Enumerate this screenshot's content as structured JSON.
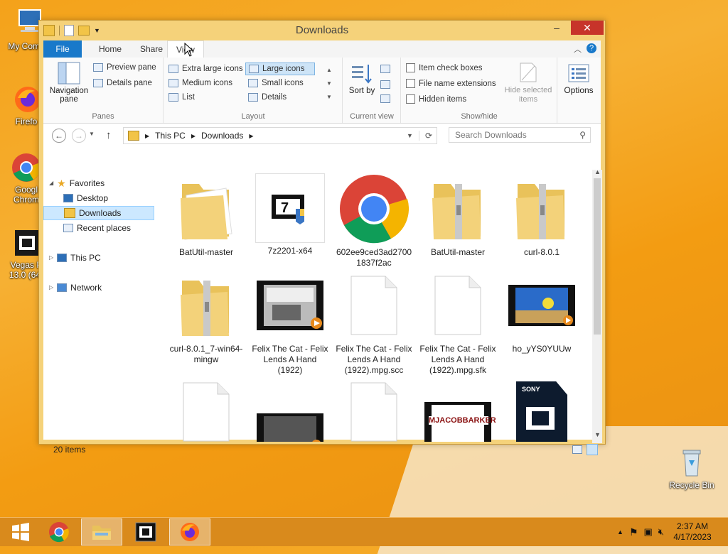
{
  "desktop": {
    "icons": [
      {
        "label": "My Comp",
        "icon": "computer-icon"
      },
      {
        "label": "Firefo",
        "icon": "firefox-icon"
      },
      {
        "label": "Googl Chrom",
        "icon": "chrome-icon"
      },
      {
        "label": "Vegas P 13.0 (64-",
        "icon": "vegas-icon"
      },
      {
        "label": "Recycle Bin",
        "icon": "recycle-bin-icon"
      }
    ]
  },
  "window": {
    "title": "Downloads",
    "controls": {
      "minimize": "–",
      "maximize": "☐",
      "close": "✕"
    }
  },
  "ribbon": {
    "tabs": [
      "File",
      "Home",
      "Share",
      "View"
    ],
    "panes": {
      "navigation_pane": "Navigation pane",
      "preview_pane": "Preview pane",
      "details_pane": "Details pane",
      "label": "Panes"
    },
    "layout": {
      "options": [
        "Extra large icons",
        "Large icons",
        "Medium icons",
        "Small icons",
        "List",
        "Details"
      ],
      "selected": "Large icons",
      "label": "Layout"
    },
    "current_view": {
      "sort_by": "Sort by",
      "label": "Current view"
    },
    "show_hide": {
      "item_check_boxes": "Item check boxes",
      "file_name_extensions": "File name extensions",
      "hidden_items": "Hidden items",
      "hide_selected": "Hide selected items",
      "label": "Show/hide"
    },
    "options": "Options"
  },
  "address": {
    "path": [
      "This PC",
      "Downloads"
    ],
    "search_placeholder": "Search Downloads"
  },
  "nav": {
    "favorites": "Favorites",
    "desktop": "Desktop",
    "downloads": "Downloads",
    "recent": "Recent places",
    "this_pc": "This PC",
    "network": "Network"
  },
  "files": [
    {
      "name": "BatUtil-master",
      "type": "folder"
    },
    {
      "name": "7z2201-x64",
      "type": "7zip-installer"
    },
    {
      "name": "602ee9ced3ad27001837f2ac",
      "type": "chrome"
    },
    {
      "name": "BatUtil-master",
      "type": "zip-folder"
    },
    {
      "name": "curl-8.0.1",
      "type": "zip-folder"
    },
    {
      "name": "curl-8.0.1_7-win64-mingw",
      "type": "zip-folder"
    },
    {
      "name": "Felix The Cat - Felix Lends A Hand (1922)",
      "type": "video"
    },
    {
      "name": "Felix The Cat - Felix Lends A Hand (1922).mpg.scc",
      "type": "blank"
    },
    {
      "name": "Felix The Cat - Felix Lends A Hand (1922).mpg.sfk",
      "type": "blank"
    },
    {
      "name": "ho_yYS0YUUw",
      "type": "video-blue"
    },
    {
      "name": "",
      "type": "blank"
    },
    {
      "name": "",
      "type": "video-dark"
    },
    {
      "name": "",
      "type": "blank"
    },
    {
      "name": "",
      "type": "video-text",
      "overlay": "MJACOBBARKER"
    },
    {
      "name": "",
      "type": "sony",
      "overlay": "SONY"
    }
  ],
  "status": {
    "count": "20 items"
  },
  "taskbar": {
    "time": "2:37 AM",
    "date": "4/17/2023"
  }
}
